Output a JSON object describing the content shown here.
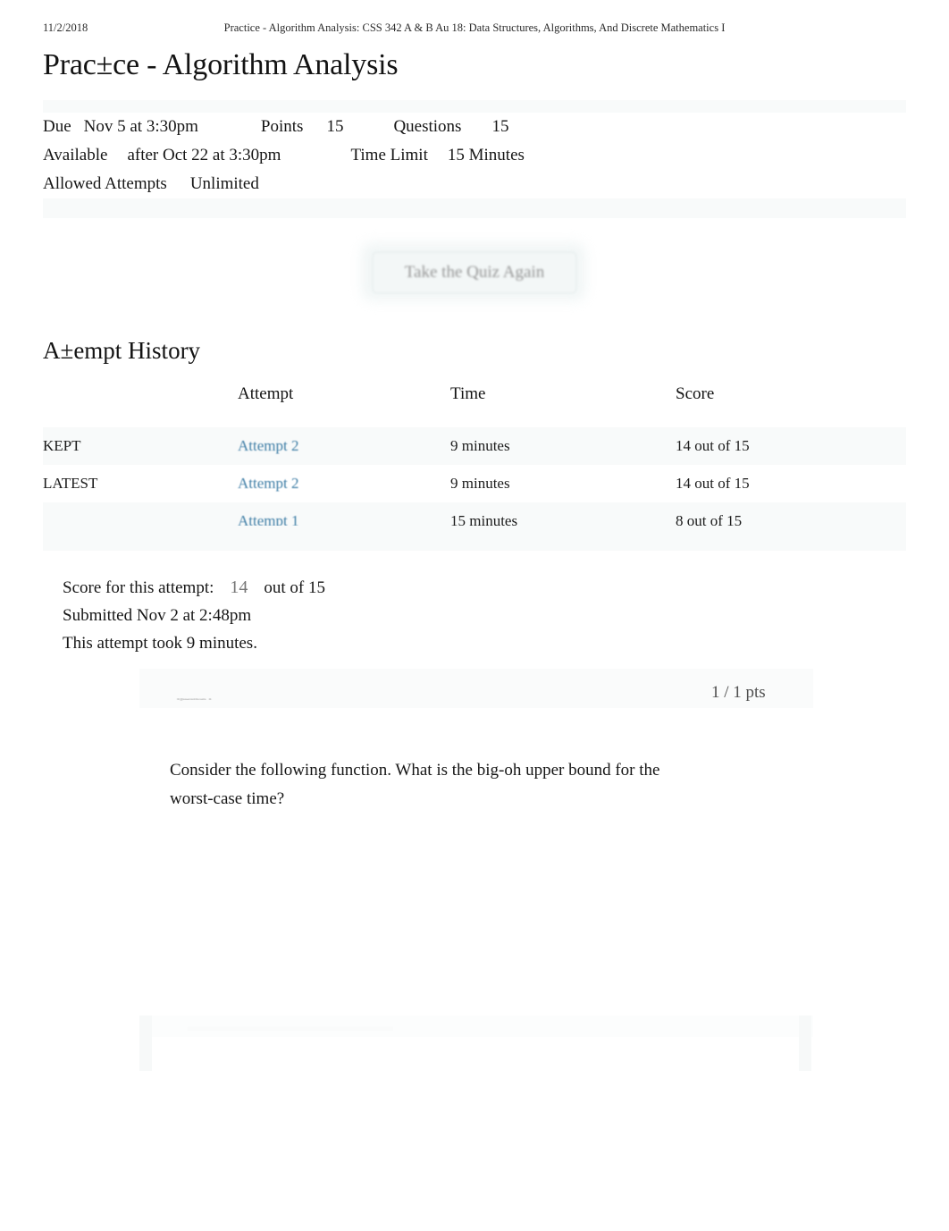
{
  "print_header": {
    "date": "11/2/2018",
    "breadcrumb": "Practice - Algorithm Analysis: CSS 342 A & B Au 18: Data Structures, Algorithms, And Discrete Mathematics I"
  },
  "page": {
    "title": "Prac±ce - Algorithm Analysis"
  },
  "quiz_info": {
    "due_label": "Due",
    "due_value": "Nov 5 at 3:30pm",
    "points_label": "Points",
    "points_value": "15",
    "questions_label": "Questions",
    "questions_value": "15",
    "available_label": "Available",
    "available_value": "after Oct 22 at 3:30pm",
    "time_limit_label": "Time Limit",
    "time_limit_value": "15 Minutes",
    "allowed_attempts_label": "Allowed Attempts",
    "allowed_attempts_value": "Unlimited"
  },
  "actions": {
    "retake_label": "Take the Quiz Again"
  },
  "attempt_history": {
    "heading": "A±empt History",
    "columns": [
      "",
      "Attempt",
      "Time",
      "Score"
    ],
    "rows": [
      {
        "flag": "KEPT",
        "attempt": "Attempt 2",
        "time": "9 minutes",
        "score": "14 out of 15"
      },
      {
        "flag": "LATEST",
        "attempt": "Attempt 2",
        "time": "9 minutes",
        "score": "14 out of 15"
      },
      {
        "flag": "",
        "attempt": "Attempt 1",
        "time": "15 minutes",
        "score": "8 out of 15"
      }
    ]
  },
  "attempt_summary": {
    "score_label": "Score for this attempt:",
    "score_value": "14",
    "score_suffix": "out of 15",
    "submitted": "Submitted Nov 2 at 2:48pm",
    "duration": "This attempt took 9 minutes."
  },
  "question": {
    "label": "Question 1",
    "points": "1 / 1 pts",
    "text": "Consider the following function. What is the big-oh upper bound for the worst-case time?"
  },
  "colors": {
    "link": "#3f7ea6",
    "band": "#f8fafa",
    "button_bg": "#f4f8f8",
    "button_text": "#8d8d8d",
    "score_highlight": "#767676"
  }
}
